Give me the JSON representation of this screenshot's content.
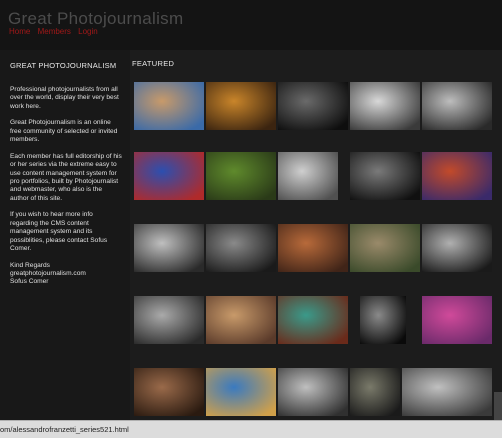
{
  "header": {
    "title": "Great Photojournalism",
    "nav": [
      "Home",
      "Members",
      "Login"
    ]
  },
  "sidebar": {
    "title": "GREAT PHOTOJOURNALISM",
    "paragraphs": [
      "Professional photojournalists from all over the world, display their very best work here.",
      "Great Photojournalism is an online free community of selected or invited members.",
      "Each member has full editorship of his or her series via the extreme easy to use content management system for pro portfolios, built by Photojournalist and webmaster, who also is the author of this site.",
      "If you wish to hear more info regarding the CMS content management system and its possiblities, please contact Sofus Comer."
    ],
    "signoff": [
      "Kind Regards",
      "greatphotojournalism.com",
      "Sofus Comer"
    ]
  },
  "main": {
    "featured_label": "FEATURED",
    "thumbs": [
      {
        "name": "thumb-bride-portrait",
        "c1": "#c89a6a",
        "c2": "#3a6aa8"
      },
      {
        "name": "thumb-golden-dust",
        "c1": "#c9852a",
        "c2": "#3b2410"
      },
      {
        "name": "thumb-dark-figures",
        "c1": "#6a6a6a",
        "c2": "#0e0e0e"
      },
      {
        "name": "thumb-street-bw",
        "c1": "#d8d8d8",
        "c2": "#3a3a3a"
      },
      {
        "name": "thumb-men-bw",
        "c1": "#bdbdbd",
        "c2": "#2a2a2a"
      },
      {
        "name": "thumb-blue-balloons",
        "c1": "#2c4fb0",
        "c2": "#b02a2a"
      },
      {
        "name": "thumb-green-field",
        "c1": "#5f8a2c",
        "c2": "#2a3a18"
      },
      {
        "name": "thumb-crowd-bw",
        "c1": "#cfcfcf",
        "c2": "#505050"
      },
      {
        "name": "thumb-man-dark",
        "c1": "#7a7a7a",
        "c2": "#101010"
      },
      {
        "name": "thumb-colorful-market",
        "c1": "#c24a2a",
        "c2": "#3a2a6a"
      },
      {
        "name": "thumb-interior-bw",
        "c1": "#bfbfbf",
        "c2": "#2a2a2a"
      },
      {
        "name": "thumb-old-man-hat",
        "c1": "#8a8a8a",
        "c2": "#1a1a1a"
      },
      {
        "name": "thumb-tv-room",
        "c1": "#b86a3a",
        "c2": "#402418"
      },
      {
        "name": "thumb-rubble-village",
        "c1": "#9a8a6a",
        "c2": "#3a4a2a"
      },
      {
        "name": "thumb-kiss-bw",
        "c1": "#b0b0b0",
        "c2": "#1a1a1a"
      },
      {
        "name": "thumb-workers-bw",
        "c1": "#aaaaaa",
        "c2": "#2a2a2a"
      },
      {
        "name": "thumb-market-table",
        "c1": "#c89a6a",
        "c2": "#5a3a2a"
      },
      {
        "name": "thumb-child-window",
        "c1": "#3a9a8a",
        "c2": "#6a2a1a"
      },
      {
        "name": "thumb-woman-portrait",
        "c1": "#8a8a8a",
        "c2": "#0a0a0a"
      },
      {
        "name": "thumb-holi-pink",
        "c1": "#d04a9a",
        "c2": "#6a2a6a"
      },
      {
        "name": "thumb-crowd-faces",
        "c1": "#9a6a4a",
        "c2": "#2a1a10"
      },
      {
        "name": "thumb-beach-umbrella",
        "c1": "#3a7ac0",
        "c2": "#d0a04a"
      },
      {
        "name": "thumb-slum-bw",
        "c1": "#bfbfbf",
        "c2": "#303030"
      },
      {
        "name": "thumb-alley",
        "c1": "#7a7a6a",
        "c2": "#1a1a1a"
      },
      {
        "name": "thumb-protest",
        "c1": "#c0c0c0",
        "c2": "#3a3a3a"
      }
    ]
  },
  "statusbar": {
    "url": "om/alessandrofranzetti_series521.html"
  }
}
